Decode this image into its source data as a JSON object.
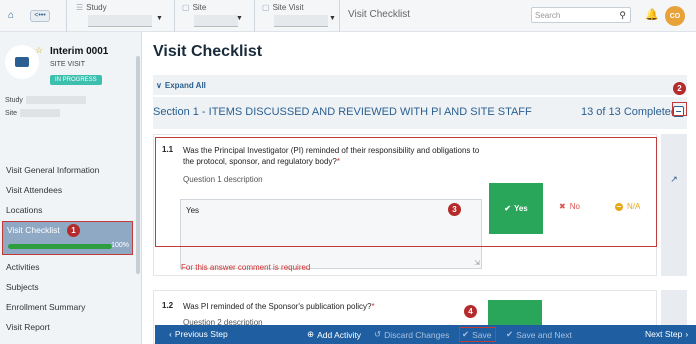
{
  "topbar": {
    "home_icon": "home-icon",
    "back_label": "<•••",
    "study_label": "Study",
    "site_label": "Site",
    "site_visit_label": "Site Visit",
    "current_page": "Visit Checklist",
    "search_placeholder": "Search",
    "avatar_initials": "CO"
  },
  "sidebar": {
    "title": "Interim 0001",
    "subtitle": "SITE VISIT",
    "status_badge": "IN PROGRESS",
    "study_label": "Study",
    "site_label": "Site",
    "nav": [
      {
        "label": "Visit General Information"
      },
      {
        "label": "Visit Attendees"
      },
      {
        "label": "Locations"
      },
      {
        "label": "Visit Checklist",
        "progress_pct": "100%",
        "progress": 1.0
      },
      {
        "label": "Activities"
      },
      {
        "label": "Subjects"
      },
      {
        "label": "Enrollment Summary"
      },
      {
        "label": "Visit Report"
      }
    ]
  },
  "markers": [
    "1",
    "2",
    "3",
    "4"
  ],
  "main": {
    "title": "Visit Checklist",
    "expand_all": "Expand All",
    "section_title": "Section 1 - ITEMS DISCUSSED AND REVIEWED WITH PI AND SITE STAFF",
    "section_count": "13 of 13 Completed",
    "questions": [
      {
        "number": "1.1",
        "text": "Was the Principal Investigator (PI) reminded of their responsibility and obligations to the protocol, sponsor, and regulatory body?",
        "required_mark": "*",
        "description": "Question 1 description",
        "answer_comment": "Yes",
        "options": {
          "yes": "Yes",
          "no": "No",
          "na": "N/A"
        },
        "selected": "Yes",
        "error": "For this answer comment is required"
      },
      {
        "number": "1.2",
        "text": "Was PI reminded of the Sponsor's publication policy?",
        "required_mark": "*",
        "description": "Question 2 description"
      }
    ]
  },
  "footer": {
    "previous": "Previous Step",
    "add_activity": "Add Activity",
    "discard": "Discard Changes",
    "save": "Save",
    "save_next": "Save and Next",
    "next": "Next Step"
  },
  "colors": {
    "accent": "#2b5f91",
    "footer": "#1f5fa1",
    "yes": "#2aa65a",
    "error": "#d32f2f",
    "marker": "#b52a2a"
  }
}
